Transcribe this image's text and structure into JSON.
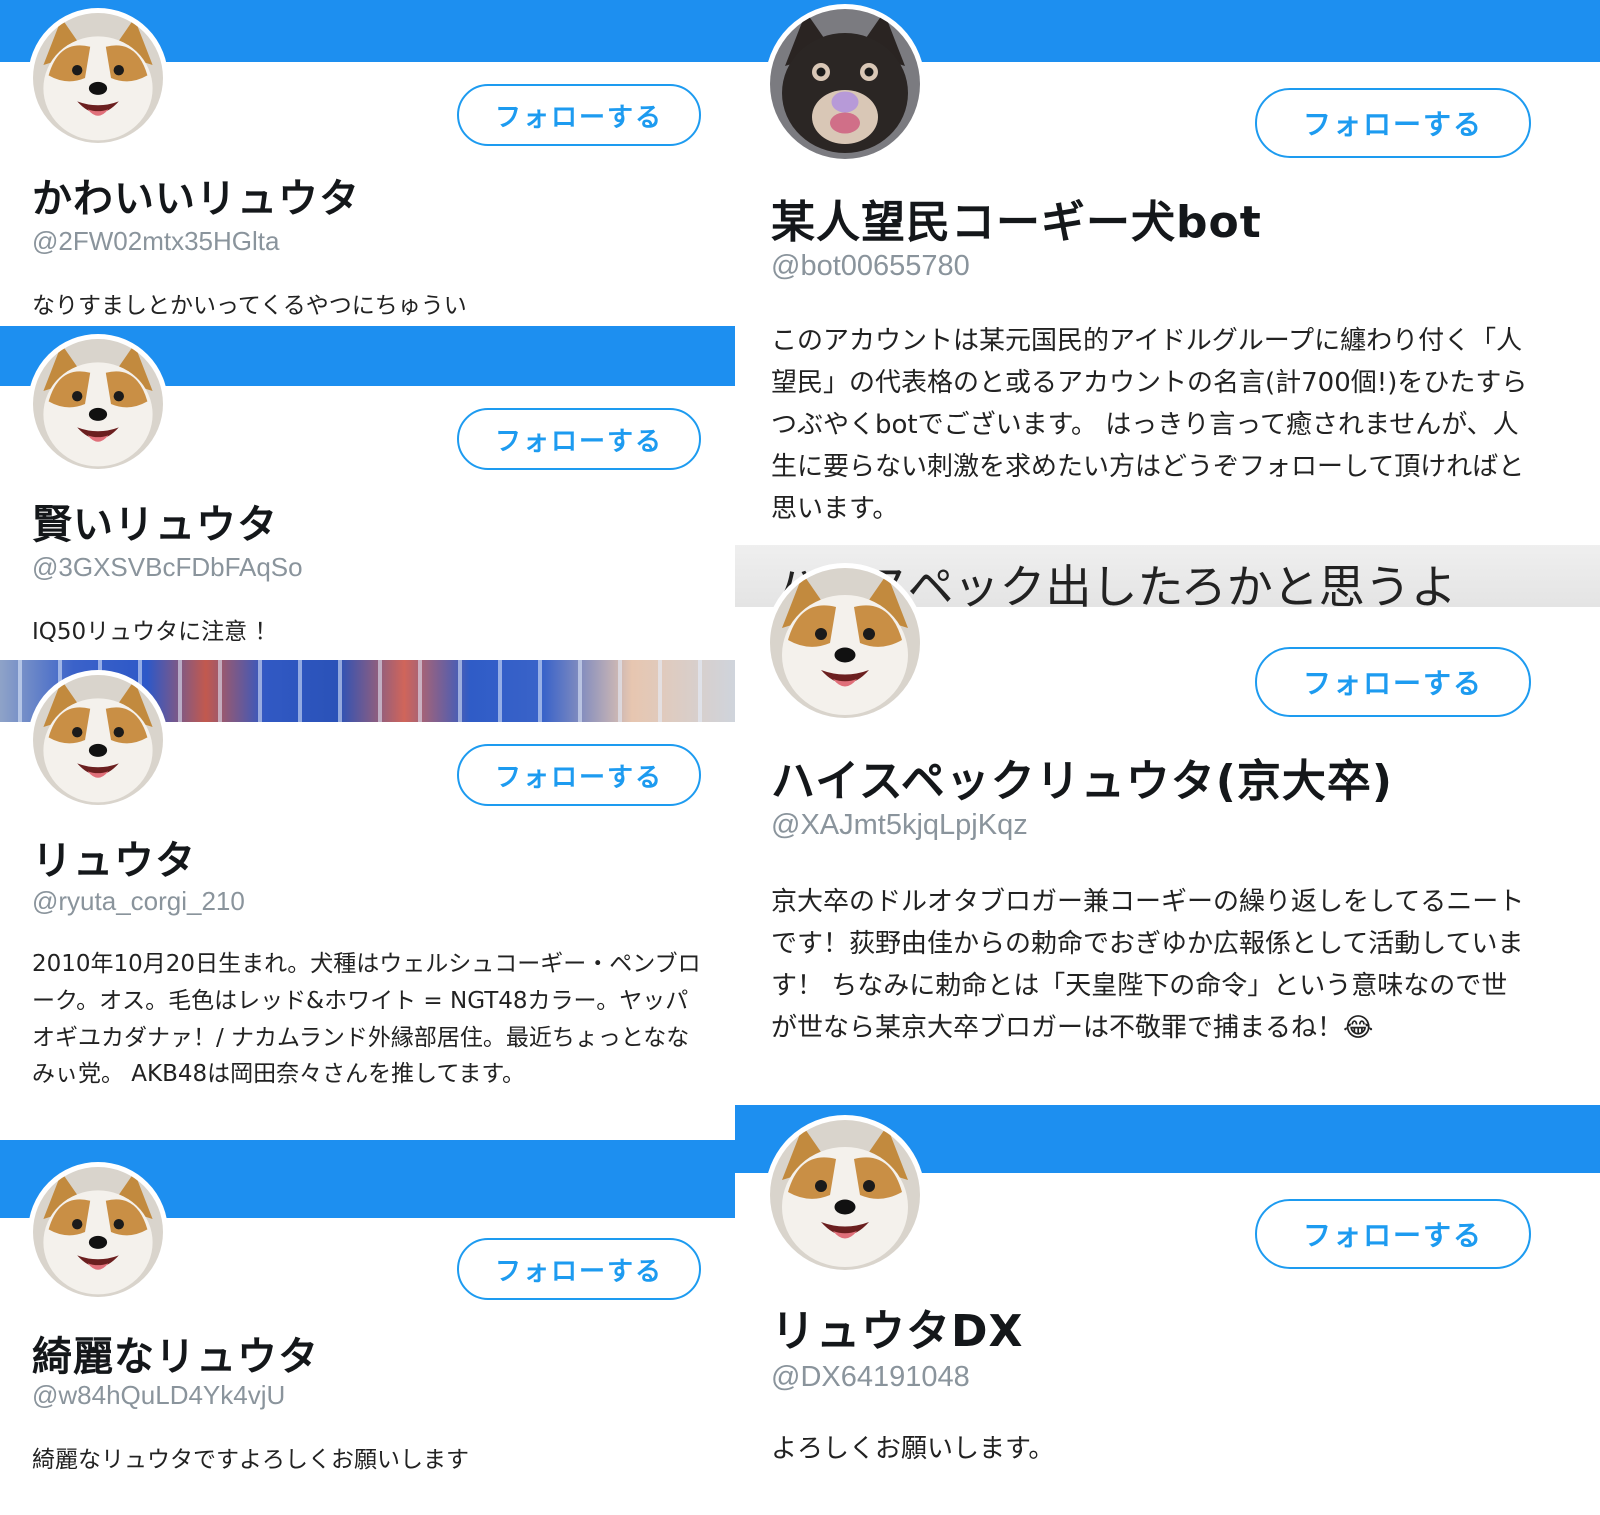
{
  "accent_color": "#1d8ff0",
  "follow_label": "フォローする",
  "left_column": [
    {
      "name": "かわいいリュウタ",
      "handle": "@2FW02mtx35HGlta",
      "bio": "なりすましとかいってくるやつにちゅうい",
      "avatar": "corgi-face-icon"
    },
    {
      "name": "賢いリュウタ",
      "handle": "@3GXSVBcFDbFAqSo",
      "bio": "IQ50リュウタに注意 ！",
      "avatar": "corgi-face-icon"
    },
    {
      "name": "リュウタ",
      "handle": "@ryuta_corgi_210",
      "bio": "2010年10月20日生まれ。犬種はウェルシュコーギー・ペンブローク。オス。毛色はレッド&ホワイト = NGT48カラー。ヤッパオギユカダナァ！/ ナカムランド外縁部居住。最近ちょっとななみぃ党。 AKB48は岡田奈々さんを推してます。",
      "avatar": "corgi-face-icon"
    },
    {
      "name": "綺麗なリュウタ",
      "handle": "@w84hQuLD4Yk4vjU",
      "bio": "綺麗なリュウタですよろしくお願いします",
      "avatar": "corgi-face-icon"
    }
  ],
  "right_column": [
    {
      "name": "某人望民コーギー犬bot",
      "handle": "@bot00655780",
      "bio": "このアカウントは某元国民的アイドルグループに纏わり付く「人望民」の代表格のと或るアカウントの名言(計700個!)をひたすらつぶやくbotでございます。 はっきり言って癒されませんが、人生に要らない刺激を求めたい方はどうぞフォローして頂ければと思います。",
      "avatar": "dark-dog-face-icon"
    },
    {
      "banner_text": "ハイスペック出したろかと思うよ",
      "name": "ハイスペックリュウタ(京大卒)",
      "handle": "@XAJmt5kjqLpjKqz",
      "bio": "京大卒のドルオタブロガー兼コーギーの繰り返しをしてるニートです！荻野由佳からの勅命でおぎゆか広報係として活動しています！ ちなみに勅命とは「天皇陛下の命令」という意味なので世が世なら某京大卒ブロガーは不敬罪で捕まるね！😂",
      "avatar": "corgi-face-icon"
    },
    {
      "name": "リュウタDX",
      "handle": "@DX64191048",
      "bio": "よろしくお願いします。",
      "avatar": "corgi-face-icon"
    }
  ]
}
